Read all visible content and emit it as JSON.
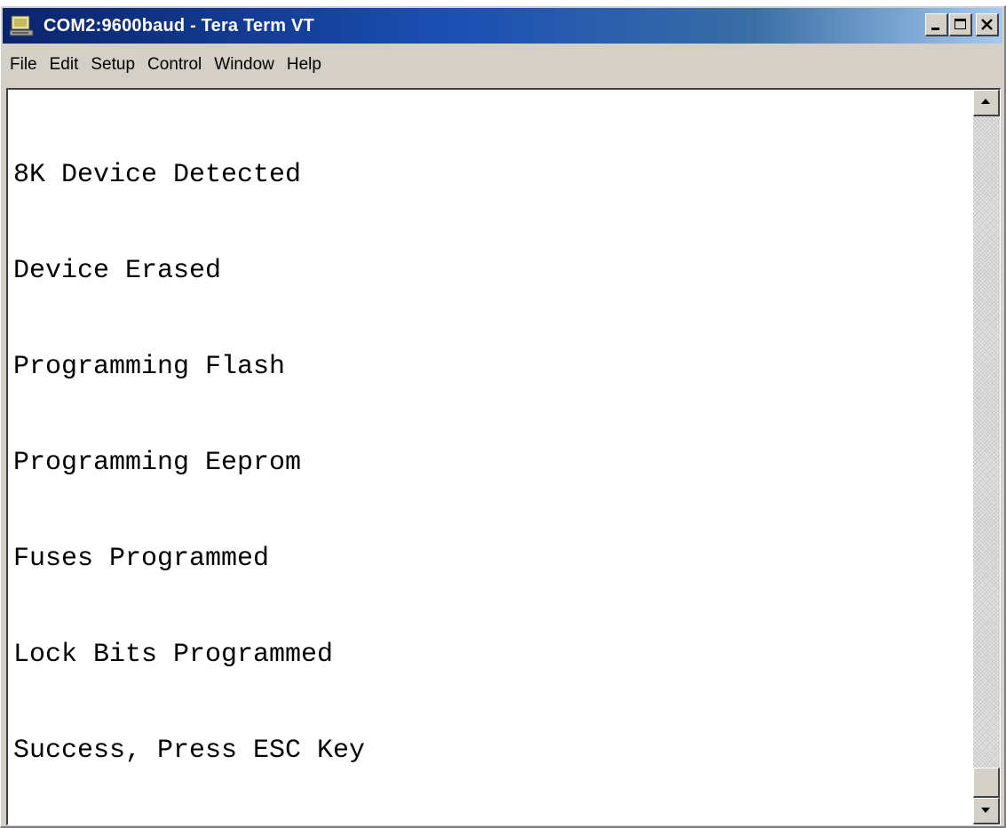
{
  "window": {
    "title": "COM2:9600baud - Tera Term VT",
    "icon": "terminal-app-icon",
    "controls": [
      "minimize-icon",
      "maximize-icon",
      "close-icon"
    ]
  },
  "menu": {
    "items": [
      "File",
      "Edit",
      "Setup",
      "Control",
      "Window",
      "Help"
    ]
  },
  "terminal": {
    "lines": [
      "8K Device Detected",
      "Device Erased",
      "Programming Flash",
      "Programming Eeprom",
      "Fuses Programmed",
      "Lock Bits Programmed",
      "Success, Press ESC Key"
    ]
  },
  "scrollbar": {
    "up_icon": "arrow-up-icon",
    "down_icon": "arrow-down-icon"
  },
  "colors": {
    "title_bar": "#0a246a",
    "chrome": "#d4d0c8",
    "terminal_bg": "#ffffff",
    "terminal_text": "#000000"
  }
}
